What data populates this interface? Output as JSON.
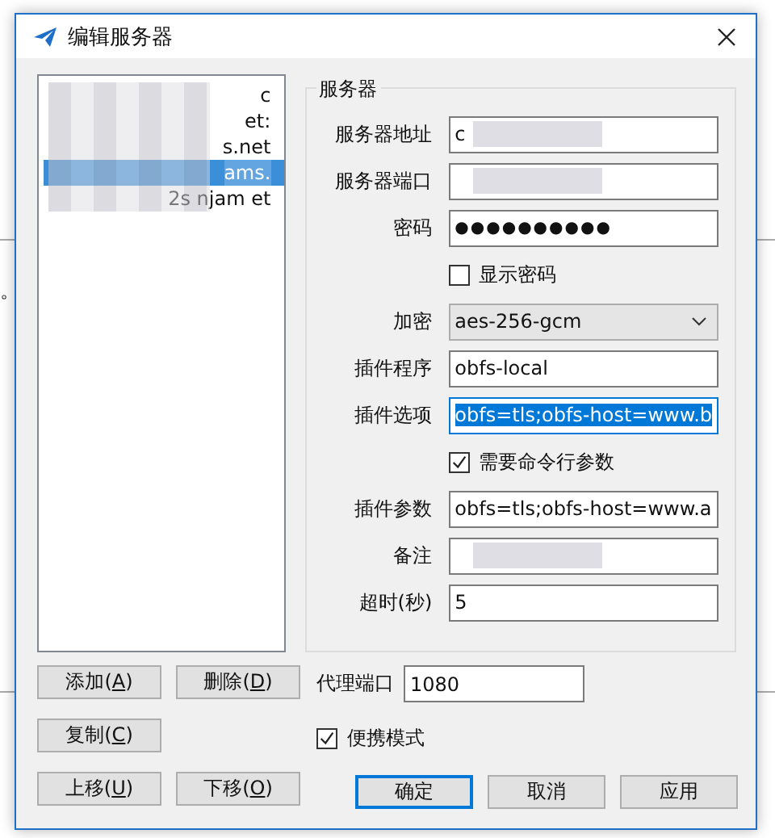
{
  "background": {
    "text": "。"
  },
  "window": {
    "title": "编辑服务器"
  },
  "server_list": [
    {
      "text": "c",
      "selected": false
    },
    {
      "text": "et:",
      "selected": false
    },
    {
      "text": "s.net",
      "selected": false
    },
    {
      "text": "ams.",
      "selected": true
    },
    {
      "text": "2s   njam   et",
      "selected": false
    }
  ],
  "server_group": {
    "title": "服务器",
    "fields": [
      {
        "kind": "text",
        "label": "服务器地址",
        "value": "c"
      },
      {
        "kind": "text",
        "label": "服务器端口"
      },
      {
        "kind": "password",
        "label": "密码",
        "value": "●●●●●●●●●●"
      },
      {
        "kind": "checkbox",
        "label": "显示密码",
        "checked": false
      },
      {
        "kind": "select",
        "label": "加密",
        "value": "aes-256-gcm"
      },
      {
        "kind": "text",
        "label": "插件程序",
        "value": "obfs-local"
      },
      {
        "kind": "selected-text",
        "label": "插件选项",
        "value": "obfs=tls;obfs-host=www.b"
      },
      {
        "kind": "checkbox",
        "label": "需要命令行参数",
        "checked": true
      },
      {
        "kind": "text",
        "label": "插件参数",
        "value": "obfs=tls;obfs-host=www.a"
      },
      {
        "kind": "text",
        "label": "备注"
      },
      {
        "kind": "text",
        "label": "超时(秒)",
        "value": "5"
      }
    ]
  },
  "list_buttons": [
    [
      "添加(**A**)",
      "删除(**D**)"
    ],
    [
      "复制(**C**)"
    ],
    [
      "上移(**U**)",
      "下移(**O**)"
    ]
  ],
  "proxy_port": {
    "label": "代理端口",
    "value": "1080"
  },
  "portable_mode": {
    "label": "便携模式",
    "checked": true
  },
  "dialog_buttons": [
    {
      "label": "确定",
      "default": true
    },
    {
      "label": "取消",
      "default": false
    },
    {
      "label": "应用",
      "default": false
    }
  ]
}
